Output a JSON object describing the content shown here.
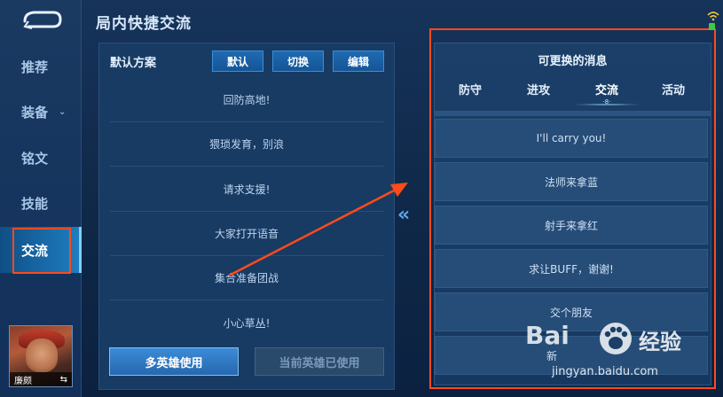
{
  "header": {
    "title": "局内快捷交流"
  },
  "sidebar": {
    "items": [
      {
        "label": "推荐"
      },
      {
        "label": "装备",
        "chevron": "⌄"
      },
      {
        "label": "铭文"
      },
      {
        "label": "技能"
      },
      {
        "label": "交流",
        "active": true
      }
    ],
    "avatar": {
      "name": "廉颇",
      "swap_icon": "⇆"
    }
  },
  "left_panel": {
    "scheme_label": "默认方案",
    "buttons": {
      "default": "默认",
      "switch": "切换",
      "edit": "编辑"
    },
    "messages": [
      "回防高地!",
      "猥琐发育，别浪",
      "请求支援!",
      "大家打开语音",
      "集合准备团战",
      "小心草丛!"
    ],
    "multi_hero_button": "多英雄使用",
    "current_hero_button": "当前英雄已使用"
  },
  "middle": {
    "chevron": "«"
  },
  "right_panel": {
    "title": "可更换的消息",
    "tabs": [
      "防守",
      "进攻",
      "交流",
      "活动"
    ],
    "active_tab": "交流",
    "tab_indicator": "·8·",
    "items": [
      "I'll carry you!",
      "法师来拿蓝",
      "射手来拿红",
      "求让BUFF，谢谢!",
      "交个朋友",
      "新"
    ]
  },
  "watermark": {
    "brand": "Bai",
    "brand_cn": "经验",
    "url": "jingyan.baidu.com"
  },
  "colors": {
    "accent": "#1f6ab2",
    "annotation": "#ff4a1a",
    "panel": "#183b63",
    "battery": "#3ec84a"
  }
}
